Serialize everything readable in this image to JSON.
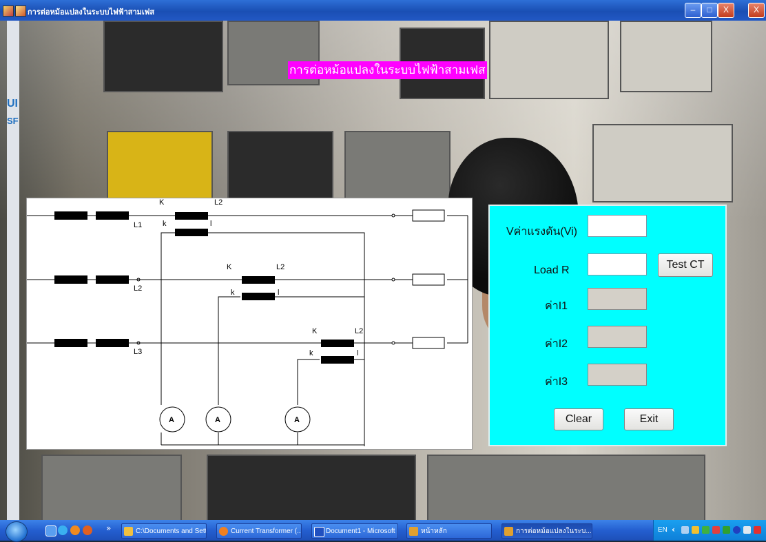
{
  "window": {
    "title": "การต่อหม้อแปลงในระบบไฟฟ้าสามเฟส",
    "controls": {
      "minimize": "–",
      "maximize": "□",
      "close": "X",
      "outer_close": "X"
    }
  },
  "left_strip": {
    "line1": "UI",
    "line2": "SF"
  },
  "heading": "การต่อหม้อแปลงในระบบไฟฟ้าสามเฟส",
  "diagram": {
    "phase_labels": [
      "L1",
      "L2",
      "L3"
    ],
    "ct_primary_label": "K",
    "ct_secondary_label": "k",
    "ct_out_labels": [
      "L2",
      "L2",
      "L2"
    ],
    "ct_l_label": "l",
    "ammeter_label": "A"
  },
  "form": {
    "vi_label": "Vค่าแรงดัน(Vi)",
    "vi_value": "",
    "load_label": "Load R",
    "load_value": "",
    "test_button": "Test CT",
    "i1_label": "ค่าI1",
    "i1_value": "",
    "i2_label": "ค่าI2",
    "i2_value": "",
    "i3_label": "ค่าI3",
    "i3_value": "",
    "clear_button": "Clear",
    "exit_button": "Exit"
  },
  "taskbar": {
    "more": "»",
    "items": [
      {
        "label": "C:\\Documents and Sett...",
        "icon_color": "#f0c040"
      },
      {
        "label": "Current Transformer (...",
        "icon_color": "#f08020"
      },
      {
        "label": "Document1 - Microsoft ...",
        "icon_color": "#2050c0"
      },
      {
        "label": "หน้าหลัก",
        "icon_color": "#e0a030"
      },
      {
        "label": "การต่อหม้อแปลงในระบ...",
        "icon_color": "#e0a030"
      }
    ],
    "tray": {
      "lang": "EN",
      "arrow": "‹"
    }
  }
}
